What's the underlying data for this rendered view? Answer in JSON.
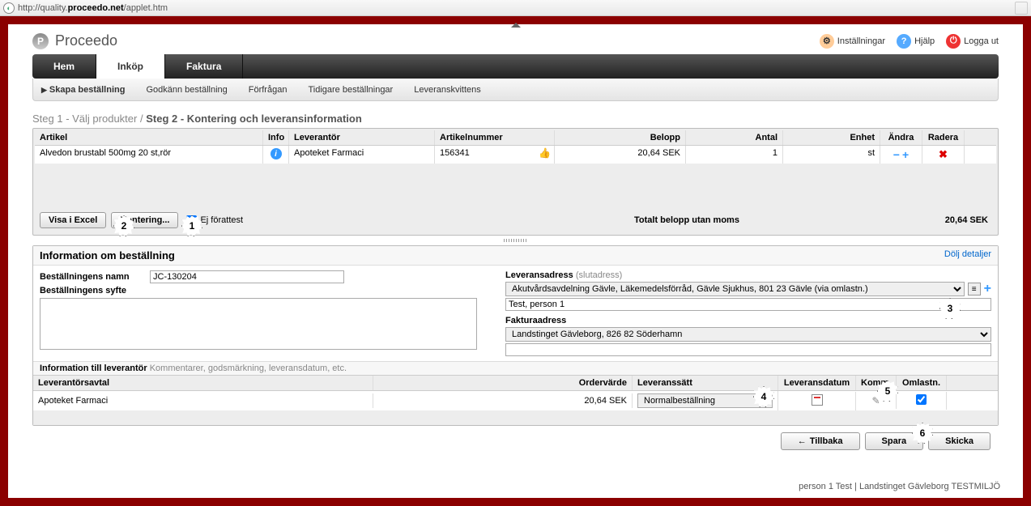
{
  "browser": {
    "url_prefix": "http://quality.",
    "url_bold": "proceedo.net",
    "url_suffix": "/applet.htm"
  },
  "logo": "Proceedo",
  "header_links": {
    "settings": "Inställningar",
    "help": "Hjälp",
    "logout": "Logga ut"
  },
  "main_tabs": [
    "Hem",
    "Inköp",
    "Faktura"
  ],
  "main_tab_active": 1,
  "sub_tabs": [
    "Skapa beställning",
    "Godkänn beställning",
    "Förfrågan",
    "Tidigare beställningar",
    "Leveranskvittens"
  ],
  "sub_tab_active": 0,
  "breadcrumb": {
    "step1": "Steg 1 - Välj produkter",
    "sep": "/",
    "step2": "Steg 2 - Kontering och leveransinformation"
  },
  "grid": {
    "headers": {
      "artikel": "Artikel",
      "info": "Info",
      "leverantor": "Leverantör",
      "artikelnummer": "Artikelnummer",
      "belopp": "Belopp",
      "antal": "Antal",
      "enhet": "Enhet",
      "andra": "Ändra",
      "radera": "Radera"
    },
    "row": {
      "artikel": "Alvedon brustabl 500mg 20 st,rör",
      "leverantor": "Apoteket Farmaci",
      "artikelnummer": "156341",
      "belopp": "20,64 SEK",
      "antal": "1",
      "enhet": "st"
    }
  },
  "buttons": {
    "visa_excel": "Visa i Excel",
    "kontering": "Kontering...",
    "ej_forattest": "Ej förattest"
  },
  "totals": {
    "label": "Totalt belopp utan moms",
    "value": "20,64 SEK"
  },
  "info_section": {
    "title": "Information om beställning",
    "hide": "Dölj detaljer",
    "name_label": "Beställningens namn",
    "name_value": "JC-130204",
    "purpose_label": "Beställningens syfte",
    "lev_addr_label": "Leveransadress",
    "lev_addr_sub": "(slutadress)",
    "lev_addr_value": "Akutvårdsavdelning Gävle, Läkemedelsförråd, Gävle Sjukhus, 801 23 Gävle (via omlastn.)",
    "person_value": "Test, person 1",
    "fakt_label": "Fakturaadress",
    "fakt_value": "Landstinget Gävleborg, 826 82 Söderhamn"
  },
  "info_lev": {
    "label": "Information till leverantör",
    "sub": "Kommentarer, godsmärkning, leveransdatum, etc."
  },
  "grid2": {
    "headers": {
      "lev": "Leverantörsavtal",
      "ord": "Ordervärde",
      "levs": "Leveranssätt",
      "levd": "Leveransdatum",
      "komm": "Komm.",
      "oml": "Omlastn."
    },
    "row": {
      "lev": "Apoteket Farmaci",
      "ord": "20,64 SEK",
      "levs": "Normalbeställning"
    }
  },
  "footer": {
    "back": "Tillbaka",
    "save": "Spara",
    "send": "Skicka"
  },
  "status": "person 1 Test | Landstinget Gävleborg TESTMILJÖ",
  "callouts": {
    "c1": "1",
    "c2": "2",
    "c3": "3",
    "c4": "4",
    "c5": "5",
    "c6": "6"
  }
}
